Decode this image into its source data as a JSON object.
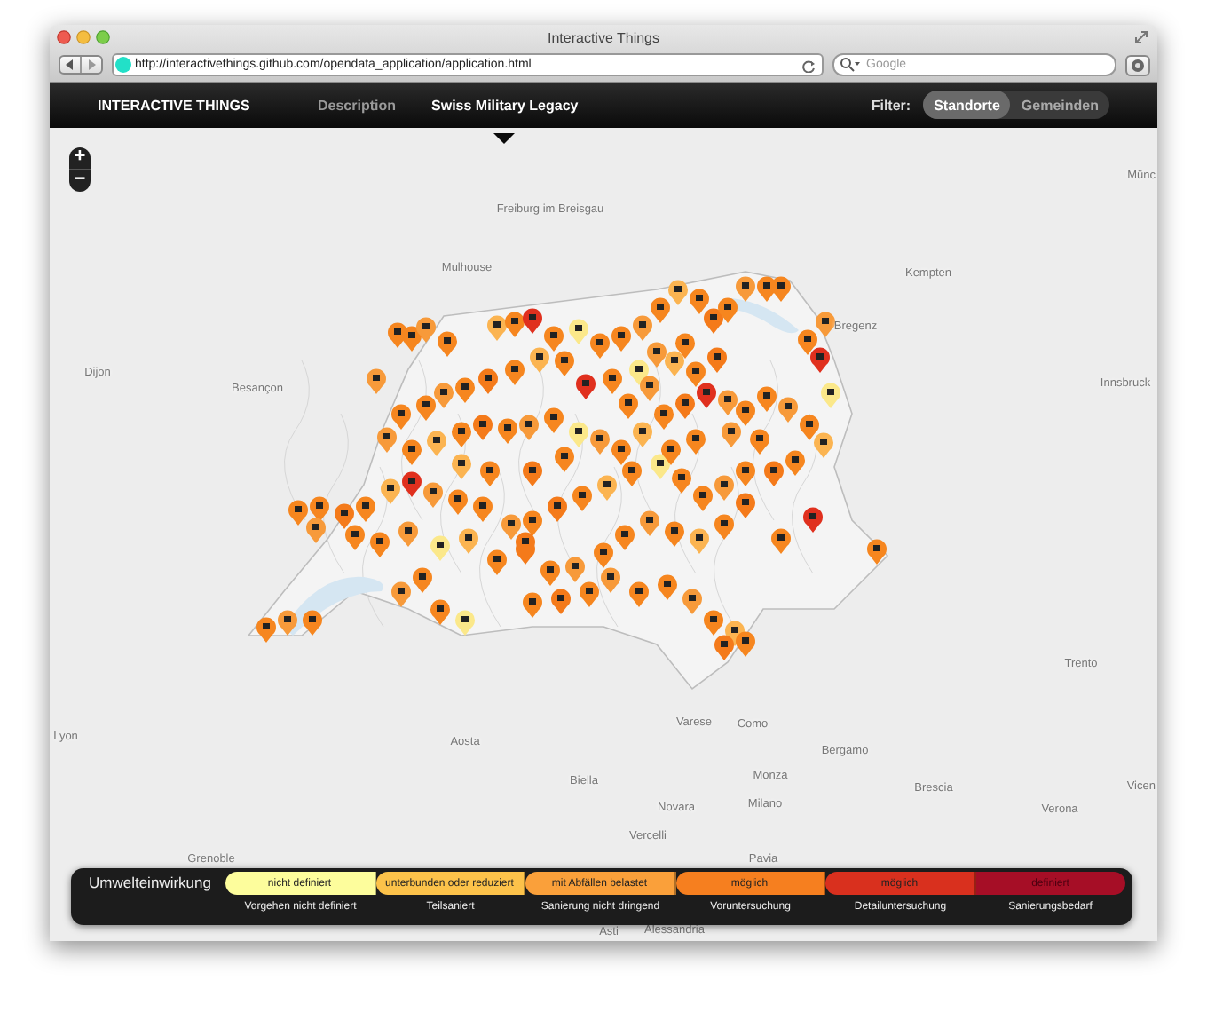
{
  "window": {
    "title": "Interactive Things"
  },
  "toolbar": {
    "url": "http://interactivethings.github.com/opendata_application/application.html",
    "search": {
      "placeholder": "Google"
    }
  },
  "navbar": {
    "brand": "INTERACTIVE THINGS",
    "tabs": [
      {
        "label": "Description",
        "selected": false
      },
      {
        "label": "Swiss Military Legacy",
        "selected": true
      }
    ],
    "filter": {
      "label": "Filter:",
      "options": [
        {
          "label": "Standorte",
          "selected": true
        },
        {
          "label": "Gemeinden",
          "selected": false
        }
      ]
    }
  },
  "map": {
    "zoom_in": "+",
    "zoom_out": "−",
    "places": [
      "Münc",
      "Freiburg im Breisgau",
      "Mulhouse",
      "Kempten",
      "Bregenz",
      "Dijon",
      "Innsbruck",
      "Besançon",
      "Trento",
      "Varese",
      "Como",
      "Lyon",
      "Aosta",
      "Bergamo",
      "Monza",
      "Biella",
      "Brescia",
      "Vicen",
      "Milano",
      "Novara",
      "Verona",
      "Vercelli",
      "Grenoble",
      "Pavia",
      "Alessandria",
      "Asti"
    ]
  },
  "legend": {
    "title": "Umwelteinwirkung",
    "classes": [
      {
        "top": "nicht definiert",
        "bottom": "Vorgehen nicht definiert",
        "color": "#fdfd9c"
      },
      {
        "top": "unterbunden oder reduziert",
        "bottom": "Teilsaniert",
        "color": "#fcc24a"
      },
      {
        "top": "mit Abfällen belastet",
        "bottom": "Sanierung nicht dringend",
        "color": "#faa03a"
      },
      {
        "top": "möglich",
        "bottom": "Voruntersuchung",
        "color": "#f67f1f"
      },
      {
        "top": "möglich",
        "bottom": "Detailuntersuchung",
        "color": "#d9301e"
      },
      {
        "top": "definiert",
        "bottom": "Sanierungsbedarf",
        "color": "#a60e26"
      }
    ]
  }
}
